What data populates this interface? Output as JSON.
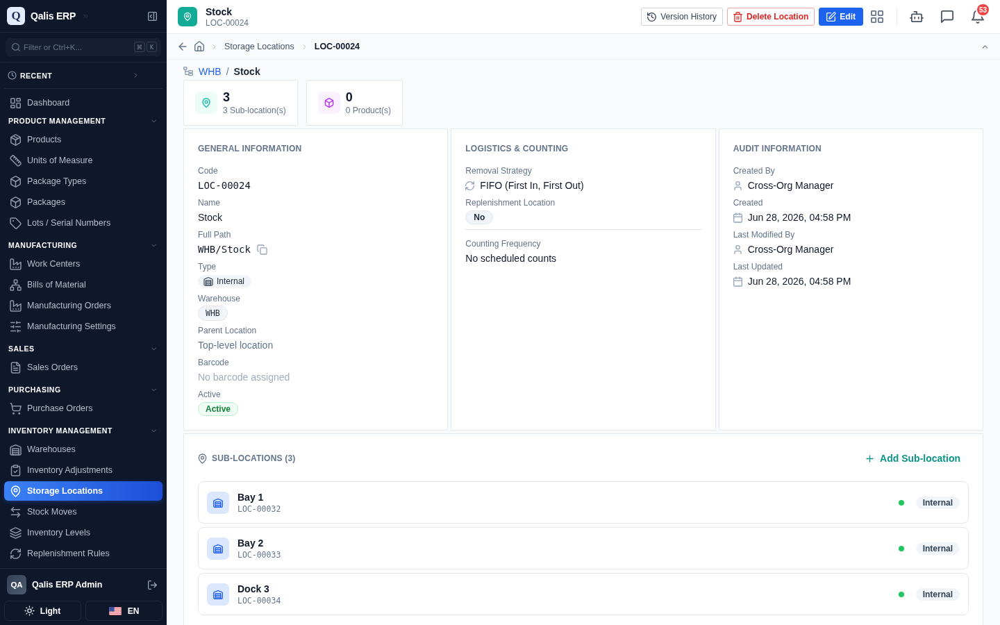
{
  "sidebar": {
    "brand": {
      "logo_letter": "Q",
      "name": "Qalis ERP"
    },
    "search": {
      "placeholder": "Filter or Ctrl+K...",
      "shortcut": [
        "⌘",
        "K"
      ]
    },
    "recent": {
      "label": "RECENT",
      "expanded": false
    },
    "top_items": [
      {
        "label": "Dashboard",
        "selected": false
      }
    ],
    "sections": [
      {
        "title": "PRODUCT MANAGEMENT",
        "expanded": true,
        "items": [
          {
            "label": "Products",
            "selected": false
          },
          {
            "label": "Units of Measure",
            "selected": false
          },
          {
            "label": "Package Types",
            "selected": false
          },
          {
            "label": "Packages",
            "selected": false
          },
          {
            "label": "Lots / Serial Numbers",
            "selected": false
          }
        ]
      },
      {
        "title": "MANUFACTURING",
        "expanded": true,
        "items": [
          {
            "label": "Work Centers",
            "selected": false
          },
          {
            "label": "Bills of Material",
            "selected": false
          },
          {
            "label": "Manufacturing Orders",
            "selected": false
          },
          {
            "label": "Manufacturing Settings",
            "selected": false
          }
        ]
      },
      {
        "title": "SALES",
        "expanded": true,
        "items": [
          {
            "label": "Sales Orders",
            "selected": false
          }
        ]
      },
      {
        "title": "PURCHASING",
        "expanded": true,
        "items": [
          {
            "label": "Purchase Orders",
            "selected": false
          }
        ]
      },
      {
        "title": "INVENTORY MANAGEMENT",
        "expanded": true,
        "items": [
          {
            "label": "Warehouses",
            "selected": false
          },
          {
            "label": "Inventory Adjustments",
            "selected": false
          },
          {
            "label": "Storage Locations",
            "selected": true
          },
          {
            "label": "Stock Moves",
            "selected": false
          },
          {
            "label": "Inventory Levels",
            "selected": false
          },
          {
            "label": "Replenishment Rules",
            "selected": false
          }
        ]
      }
    ],
    "user": {
      "initials": "QA",
      "name": "Qalis ERP Admin"
    },
    "theme_button": "Light",
    "language_button": "EN"
  },
  "header": {
    "title": "Stock",
    "subtitle": "LOC-00024",
    "buttons": [
      {
        "label": "Version History",
        "kind": "outline"
      },
      {
        "label": "Delete Location",
        "kind": "danger"
      },
      {
        "label": "Edit",
        "kind": "primary"
      }
    ],
    "notification_count": "53"
  },
  "breadcrumb": {
    "items": [
      {
        "label": "Storage Locations",
        "current": false
      },
      {
        "label": "LOC-00024",
        "current": true
      }
    ]
  },
  "location_path": {
    "parent": "WHB",
    "separator": "/",
    "name": "Stock"
  },
  "stats": [
    {
      "kind": "sub_locations",
      "value": "3",
      "label": "3 Sub-location(s)"
    },
    {
      "kind": "products",
      "value": "0",
      "label": "0 Product(s)"
    }
  ],
  "info_cards": [
    {
      "title": "GENERAL INFORMATION",
      "sections": [
        {
          "fields": [
            {
              "label": "Code",
              "value": "LOC-00024",
              "kind": "mono"
            },
            {
              "label": "Name",
              "value": "Stock",
              "kind": "text"
            },
            {
              "label": "Full Path",
              "value": "WHB/Stock",
              "kind": "copyable"
            },
            {
              "label": "Type",
              "value": "Internal",
              "kind": "type_badge"
            },
            {
              "label": "Warehouse",
              "value": "WHB",
              "kind": "code_badge"
            },
            {
              "label": "Parent Location",
              "value": "Top-level location",
              "kind": "muted"
            },
            {
              "label": "Barcode",
              "value": "No barcode assigned",
              "kind": "empty"
            },
            {
              "label": "Active",
              "value": "Active",
              "kind": "status"
            }
          ]
        }
      ]
    },
    {
      "title": "LOGISTICS & COUNTING",
      "sections": [
        {
          "fields": [
            {
              "label": "Removal Strategy",
              "value": "FIFO (First In, First Out)",
              "kind": "strategy"
            },
            {
              "label": "Replenishment Location",
              "value": "No",
              "kind": "badge"
            }
          ]
        },
        {
          "fields": [
            {
              "label": "Counting Frequency",
              "value": "No scheduled counts",
              "kind": "text"
            }
          ]
        }
      ]
    },
    {
      "title": "AUDIT INFORMATION",
      "sections": [
        {
          "fields": [
            {
              "label": "Created By",
              "value": "Cross-Org Manager",
              "kind": "user"
            },
            {
              "label": "Created",
              "value": "Jun 28, 2026, 04:58 PM",
              "kind": "date"
            },
            {
              "label": "Last Modified By",
              "value": "Cross-Org Manager",
              "kind": "user"
            },
            {
              "label": "Last Updated",
              "value": "Jun 28, 2026, 04:58 PM",
              "kind": "date"
            }
          ]
        }
      ]
    }
  ],
  "sub_locations": {
    "title": "SUB-LOCATIONS (3)",
    "add_button": "Add Sub-location",
    "rows": [
      {
        "name": "Bay 1",
        "code": "LOC-00032",
        "color": "#22c55e",
        "type": "Internal"
      },
      {
        "name": "Bay 2",
        "code": "LOC-00033",
        "color": "#22c55e",
        "type": "Internal"
      },
      {
        "name": "Dock 3",
        "code": "LOC-00034",
        "color": "#22c55e",
        "type": "Internal"
      }
    ]
  }
}
